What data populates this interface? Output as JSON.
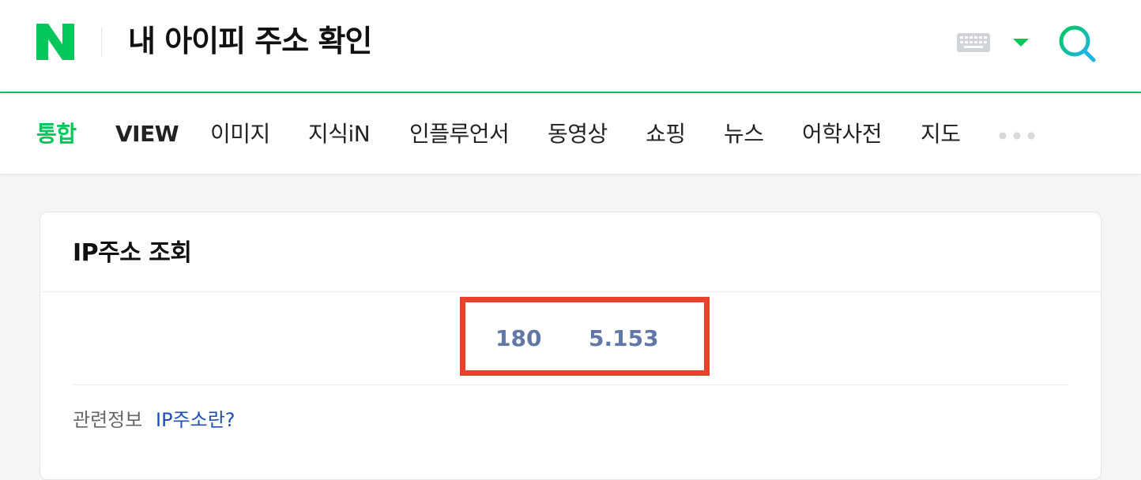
{
  "header": {
    "logo_text": "N",
    "query": "내 아이피 주소 확인",
    "keyboard_icon": "keyboard-icon",
    "dropdown_icon": "caret-down-icon",
    "search_icon": "search-icon",
    "brand_color": "#03c75a"
  },
  "tabs": [
    {
      "label": "통합",
      "active": true
    },
    {
      "label": "VIEW"
    },
    {
      "label": "이미지"
    },
    {
      "label": "지식iN"
    },
    {
      "label": "인플루언서"
    },
    {
      "label": "동영상"
    },
    {
      "label": "쇼핑"
    },
    {
      "label": "뉴스"
    },
    {
      "label": "어학사전"
    },
    {
      "label": "지도"
    }
  ],
  "more_icon": "more-dots-icon",
  "card": {
    "title": "IP주소 조회",
    "ip_parts": [
      "180",
      "5.153"
    ],
    "related_label": "관련정보",
    "related_link": "IP주소란?",
    "highlight_color": "#e8412c"
  }
}
